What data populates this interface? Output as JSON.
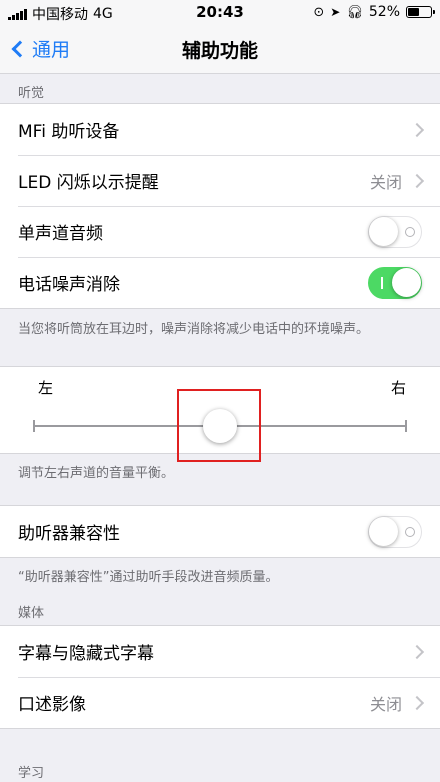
{
  "status_bar": {
    "carrier": "中国移动",
    "network": "4G",
    "time": "20:43",
    "battery_text": "52%",
    "battery_level": 0.52
  },
  "nav": {
    "back_label": "通用",
    "title": "辅助功能"
  },
  "hearing": {
    "header": "听觉",
    "items": [
      {
        "label": "MFi 助听设备",
        "value": ""
      },
      {
        "label": "LED 闪烁以示提醒",
        "value": "关闭"
      },
      {
        "label": "单声道音频",
        "toggle": false
      },
      {
        "label": "电话噪声消除",
        "toggle": true
      }
    ],
    "footer": "当您将听筒放在耳边时，噪声消除将减少电话中的环境噪声。"
  },
  "balance": {
    "left_label": "左",
    "right_label": "右",
    "value": 0.5,
    "footer": "调节左右声道的音量平衡。"
  },
  "hearing_aid": {
    "label": "助听器兼容性",
    "toggle": false,
    "footer": "“助听器兼容性”通过助听手段改进音频质量。"
  },
  "media": {
    "header": "媒体",
    "items": [
      {
        "label": "字幕与隐藏式字幕",
        "value": ""
      },
      {
        "label": "口述影像",
        "value": "关闭"
      }
    ]
  },
  "learning": {
    "header": "学习"
  },
  "colors": {
    "accent": "#1f7cf6",
    "toggle_on": "#4cd964",
    "highlight": "#e02020"
  }
}
